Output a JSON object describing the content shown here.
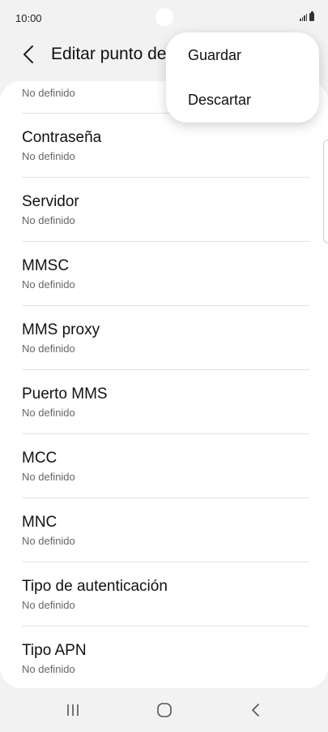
{
  "status_bar": {
    "time": "10:00"
  },
  "header": {
    "title": "Editar punto de"
  },
  "menu": {
    "items": [
      {
        "label": "Guardar"
      },
      {
        "label": "Descartar"
      }
    ]
  },
  "list": {
    "partial_value": "No definido",
    "items": [
      {
        "title": "Contraseña",
        "value": "No definido"
      },
      {
        "title": "Servidor",
        "value": "No definido"
      },
      {
        "title": "MMSC",
        "value": "No definido"
      },
      {
        "title": "MMS proxy",
        "value": "No definido"
      },
      {
        "title": "Puerto MMS",
        "value": "No definido"
      },
      {
        "title": "MCC",
        "value": "No definido"
      },
      {
        "title": "MNC",
        "value": "No definido"
      },
      {
        "title": "Tipo de autenticación",
        "value": "No definido"
      },
      {
        "title": "Tipo APN",
        "value": "No definido"
      }
    ]
  },
  "icons": {
    "back": "chevron-left-icon",
    "recents": "recent-apps-icon",
    "home": "home-icon",
    "nav_back": "nav-back-icon"
  }
}
